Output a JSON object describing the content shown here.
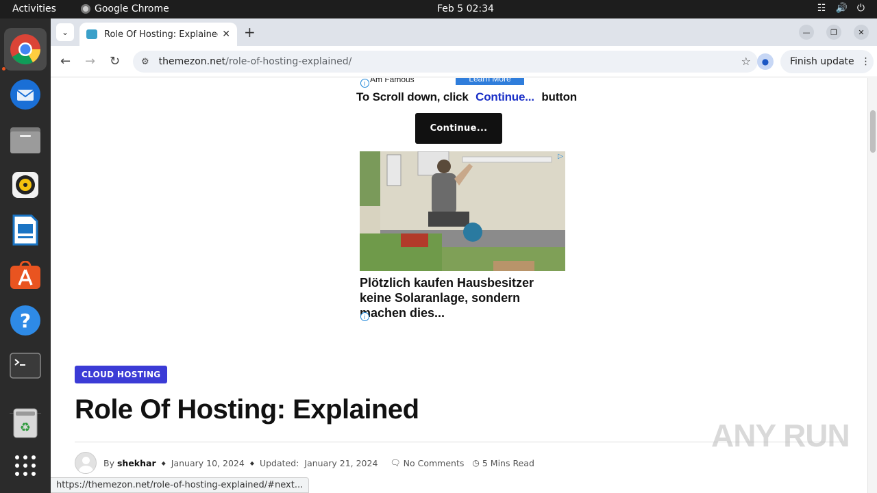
{
  "topbar": {
    "activities": "Activities",
    "app_name": "Google Chrome",
    "clock": "Feb 5  02:34"
  },
  "dock": {
    "items": [
      "chrome-icon",
      "thunderbird-icon",
      "files-icon",
      "rhythmbox-icon",
      "writer-icon",
      "app-center-icon",
      "help-icon",
      "terminal-icon",
      "trash-icon",
      "app-grid-icon"
    ]
  },
  "browser": {
    "tab_title": "Role Of Hosting: Explained",
    "url_domain": "themezon.net",
    "url_path": "/role-of-hosting-explained/",
    "finish_update": "Finish update",
    "status_url": "https://themezon.net/role-of-hosting-explained/#next..."
  },
  "ad": {
    "top_text": "Am Famous",
    "learn_more": "Learn More",
    "scroll_prefix": "To Scroll down, click",
    "scroll_link": "Continue...",
    "scroll_suffix": "button",
    "continue_button": "Continue...",
    "headline": "Plötzlich kaufen Hausbesitzer keine Solaranlage, sondern machen dies..."
  },
  "article": {
    "category": "CLOUD HOSTING",
    "title": "Role Of Hosting: Explained",
    "by_label": "By",
    "author": "shekhar",
    "published": "January 10, 2024",
    "updated_label": "Updated:",
    "updated": "January 21, 2024",
    "comments": "No Comments",
    "read_time": "5 Mins Read"
  },
  "watermark": "ANY RUN",
  "colors": {
    "accent_category": "#3b3bd6",
    "link_blue": "#1a2fc7",
    "continue_bg": "#111111"
  }
}
